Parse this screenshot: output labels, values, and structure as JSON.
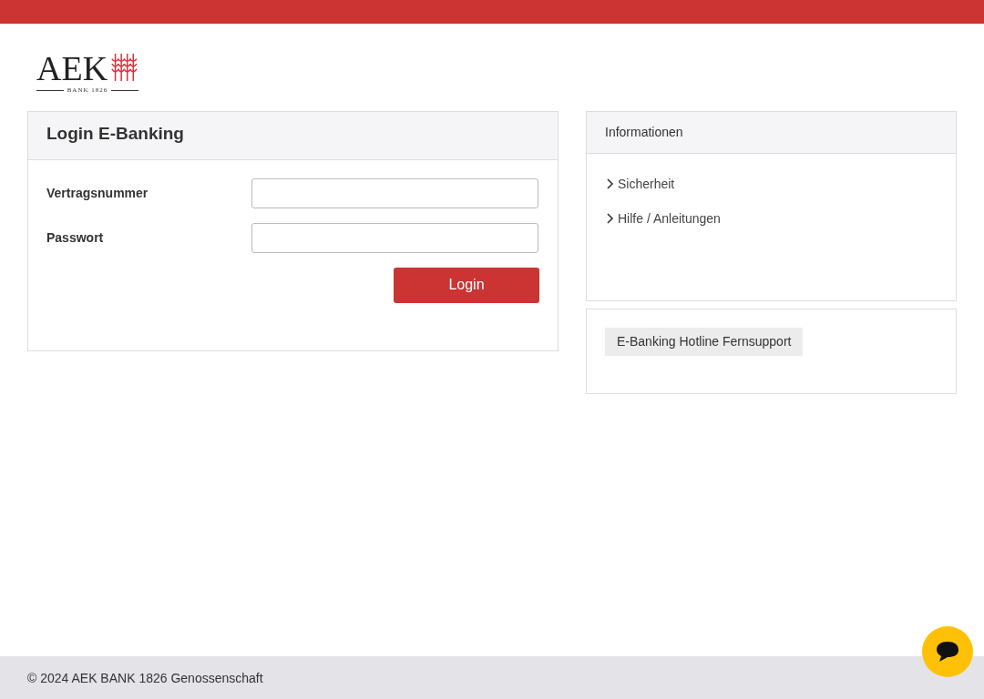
{
  "logo": {
    "name": "AEK",
    "subtitle": "BANK 1826"
  },
  "login": {
    "title": "Login E-Banking",
    "fields": [
      {
        "label": "Vertragsnummer"
      },
      {
        "label": "Passwort"
      }
    ],
    "button": "Login"
  },
  "info": {
    "title": "Informationen",
    "links": [
      "Sicherheit",
      "Hilfe / Anleitungen"
    ]
  },
  "support": {
    "button": "E-Banking Hotline Fernsupport"
  },
  "footer": "© 2024 AEK BANK 1826 Genossenschaft"
}
